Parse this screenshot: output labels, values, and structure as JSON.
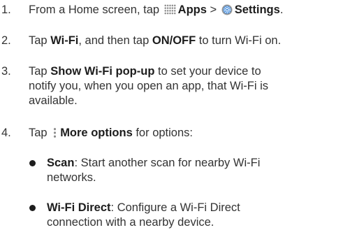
{
  "steps": [
    {
      "num": "1.",
      "pre": "From a Home screen, tap ",
      "b1": "Apps",
      "mid": " > ",
      "b2": "Settings",
      "post": "."
    },
    {
      "num": "2.",
      "pre": "Tap ",
      "b1": "Wi-Fi",
      "mid": ", and then tap ",
      "b2": "ON/OFF",
      "post": " to turn Wi-Fi on."
    },
    {
      "num": "3.",
      "pre": "Tap ",
      "b1": "Show Wi-Fi pop-up",
      "l1": " to set your device to",
      "l2": "notify you, when you open an app, that Wi-Fi is",
      "l3": "available."
    },
    {
      "num": "4.",
      "pre": "Tap ",
      "b1": "More options",
      "post": " for options:"
    }
  ],
  "bullets": [
    {
      "term": "Scan",
      "l1": ": Start another scan for nearby Wi-Fi",
      "l2": "networks."
    },
    {
      "term": "Wi-Fi Direct",
      "l1": ": Configure a Wi-Fi Direct",
      "l2": "connection with a nearby device."
    }
  ],
  "icons": {
    "apps": "apps-grid-icon",
    "settings": "settings-gear-icon",
    "more": "more-options-icon"
  }
}
